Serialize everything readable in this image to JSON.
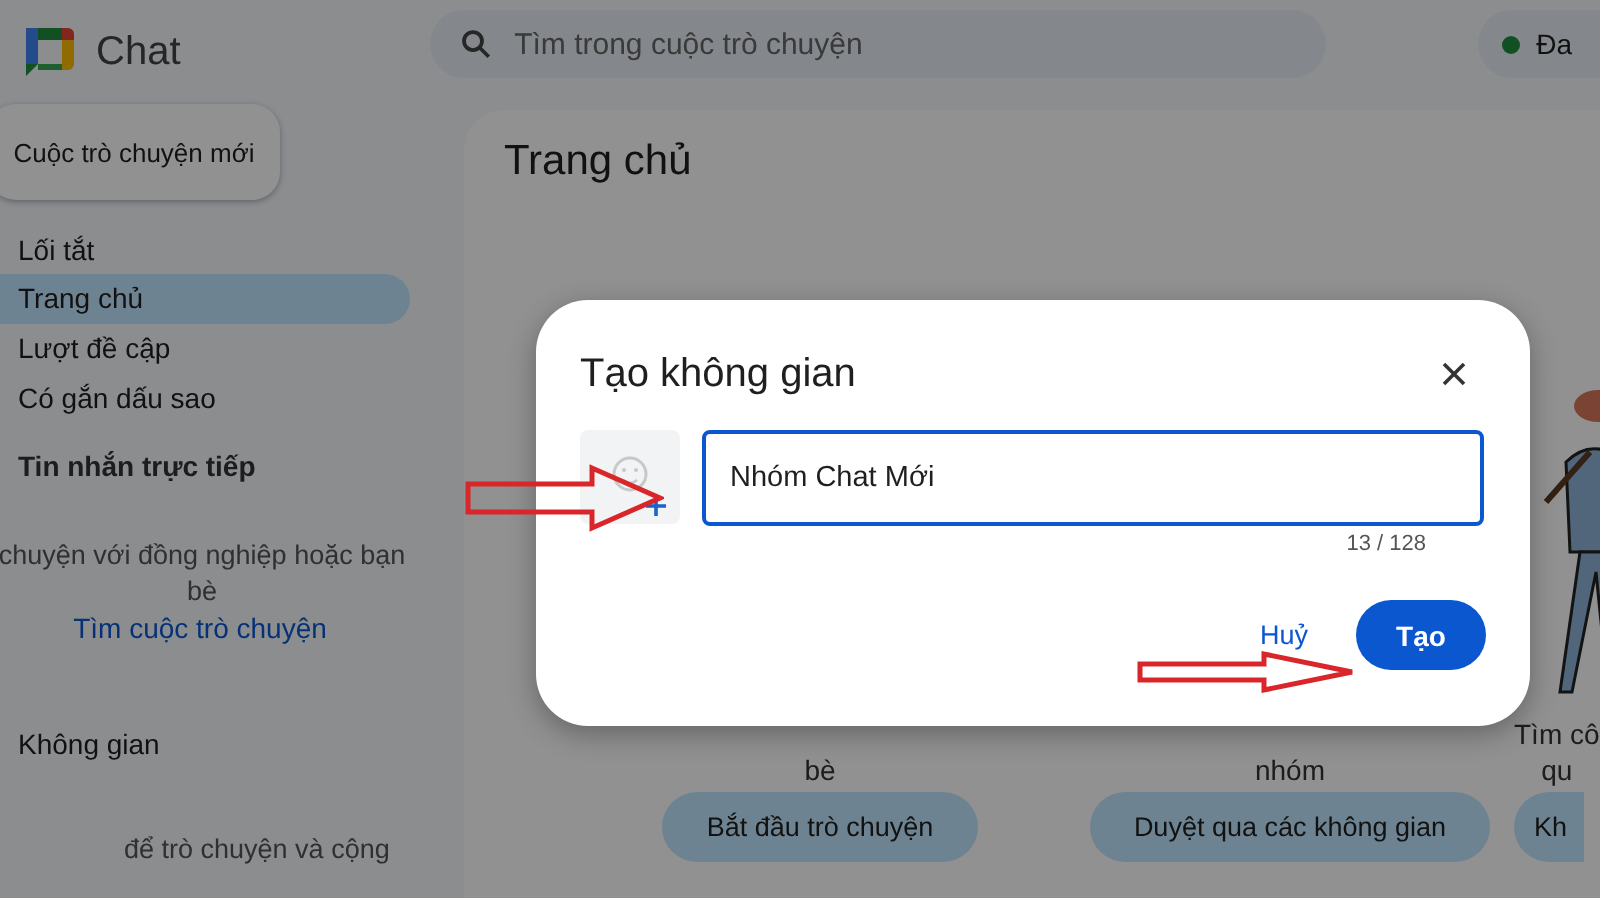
{
  "app": {
    "name": "Chat"
  },
  "search": {
    "placeholder": "Tìm trong cuộc trò chuyện"
  },
  "status": {
    "label": "Đa"
  },
  "sidebar": {
    "new_chat": "Cuộc trò chuyện mới",
    "shortcuts": {
      "title": "Lối tắt",
      "items": [
        {
          "label": "Trang chủ",
          "selected": true
        },
        {
          "label": "Lượt đề cập",
          "selected": false
        },
        {
          "label": "Có gắn dấu sao",
          "selected": false
        }
      ]
    },
    "direct_messages": {
      "title": "Tin nhắn trực tiếp",
      "hint": "chuyện với đồng nghiệp hoặc bạn\nbè",
      "link": "Tìm cuộc trò chuyện"
    },
    "spaces": {
      "title": "Không gian",
      "hint": "để trò chuyện và cộng"
    }
  },
  "main": {
    "title": "Trang chủ",
    "cards": [
      {
        "text": "bè",
        "button": "Bắt đầu trò chuyện"
      },
      {
        "text": "nhóm",
        "button": "Duyệt qua các không gian"
      },
      {
        "text": "Tìm cô\nqu",
        "button": "Kh"
      }
    ]
  },
  "dialog": {
    "title": "Tạo không gian",
    "name_field": {
      "value": "Nhóm Chat Mới",
      "counter": "13 / 128"
    },
    "buttons": [
      {
        "label": "Huỷ",
        "kind": "text"
      },
      {
        "label": "Tạo",
        "kind": "primary"
      }
    ]
  }
}
